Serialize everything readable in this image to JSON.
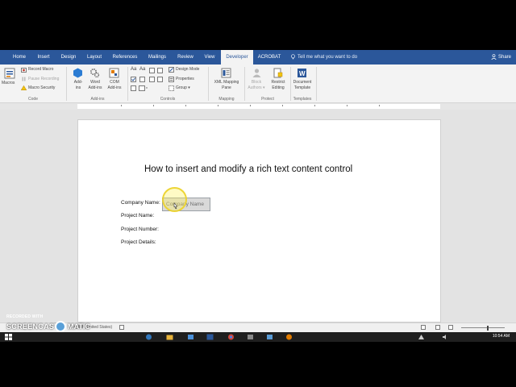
{
  "ribbon_tabs": [
    "Home",
    "Insert",
    "Design",
    "Layout",
    "References",
    "Mailings",
    "Review",
    "View",
    "Developer",
    "ACROBAT"
  ],
  "active_tab": "Developer",
  "tell_me": "Tell me what you want to do",
  "share": "Share",
  "code_group": {
    "macros": "Macros",
    "record_macro": "Record Macro",
    "pause_recording": "Pause Recording",
    "macro_security": "Macro Security",
    "label": "Code"
  },
  "addins_group": {
    "addins_1": "Add-",
    "addins_2": "ins",
    "word_addins_1": "Word",
    "word_addins_2": "Add-ins",
    "com_addins_1": "COM",
    "com_addins_2": "Add-ins",
    "label": "Add-ins"
  },
  "controls_group": {
    "design_mode": "Design Mode",
    "properties": "Properties",
    "group": "Group",
    "label": "Controls"
  },
  "mapping_group": {
    "xml_1": "XML Mapping",
    "xml_2": "Pane",
    "label": "Mapping"
  },
  "protect_group": {
    "block_1": "Block",
    "block_2": "Authors",
    "restrict_1": "Restrict",
    "restrict_2": "Editing",
    "label": "Protect"
  },
  "templates_group": {
    "doc_1": "Document",
    "doc_2": "Template",
    "label": "Templates"
  },
  "document": {
    "title": "How to insert and modify a rich text content control",
    "fields": [
      "Company Name:",
      "Project Name:",
      "Project Number:",
      "Project Details:"
    ],
    "content_control_placeholder": "Company Name"
  },
  "status": {
    "language": "English (United States)"
  },
  "clock": "10:54 AM",
  "watermark": {
    "recorded_with": "RECORDED WITH",
    "brand_left": "SCREENCAST",
    "brand_right": "MATIC"
  },
  "colors": {
    "ribbon_blue": "#2b579a",
    "highlight_yellow": "#ebd228"
  }
}
